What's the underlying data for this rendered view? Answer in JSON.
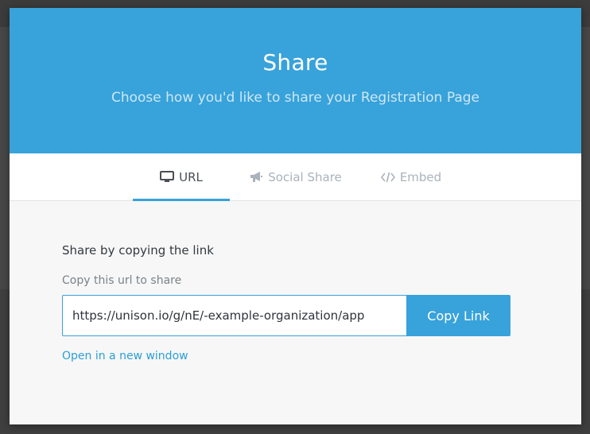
{
  "modal": {
    "title": "Share",
    "subtitle": "Choose how you'd like to share your Registration Page"
  },
  "tabs": [
    {
      "label": "URL",
      "icon": "monitor-icon",
      "active": true
    },
    {
      "label": "Social Share",
      "icon": "megaphone-icon",
      "active": false
    },
    {
      "label": "Embed",
      "icon": "code-icon",
      "active": false
    }
  ],
  "url_panel": {
    "section_title": "Share by copying the link",
    "field_label": "Copy this url to share",
    "url_value": "https://unison.io/g/nE/-example-organization/app",
    "copy_button_label": "Copy Link",
    "open_link_label": "Open in a new window"
  },
  "colors": {
    "accent": "#38a2da",
    "header_bg": "#38a2da",
    "panel_bg": "#f7f7f7",
    "link": "#2a9fd6"
  }
}
